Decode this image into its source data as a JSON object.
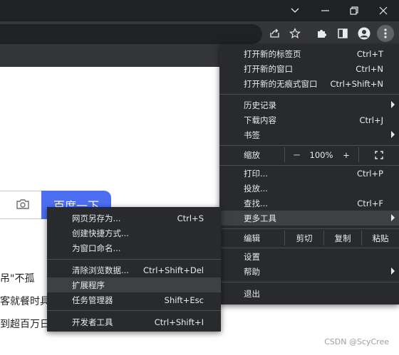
{
  "window_controls": {
    "tab_list_icon": "chevron-down-icon",
    "minimize_icon": "minimize-icon",
    "restore_icon": "restore-icon",
    "close_icon": "close-icon"
  },
  "toolbar": {
    "icons": [
      "share-icon",
      "star-icon",
      "puzzle-icon",
      "sidebar-icon",
      "profile-icon",
      "more-vert-icon"
    ]
  },
  "page": {
    "search_button": "百度一下",
    "camera_icon": "camera-icon",
    "text_lines": [
      "吊\"不孤",
      "客就餐时具",
      "到超百万日"
    ]
  },
  "main_menu": {
    "new_tab": {
      "label": "打开新的标签页",
      "shortcut": "Ctrl+T"
    },
    "new_window": {
      "label": "打开新的窗口",
      "shortcut": "Ctrl+N"
    },
    "incognito": {
      "label": "打开新的无痕式窗口",
      "shortcut": "Ctrl+Shift+N"
    },
    "history": {
      "label": "历史记录"
    },
    "downloads": {
      "label": "下载内容",
      "shortcut": "Ctrl+J"
    },
    "bookmarks": {
      "label": "书签"
    },
    "zoom": {
      "label": "缩放",
      "minus": "－",
      "value": "100%",
      "plus": "+",
      "fullscreen_icon": "fullscreen-icon"
    },
    "print": {
      "label": "打印...",
      "shortcut": "Ctrl+P"
    },
    "cast": {
      "label": "投放..."
    },
    "find": {
      "label": "查找...",
      "shortcut": "Ctrl+F"
    },
    "more_tools": {
      "label": "更多工具"
    },
    "edit": {
      "label": "编辑",
      "cut": "剪切",
      "copy": "复制",
      "paste": "粘贴"
    },
    "settings": {
      "label": "设置"
    },
    "help": {
      "label": "帮助"
    },
    "exit": {
      "label": "退出"
    }
  },
  "sub_menu": {
    "save_page": {
      "label": "网页另存为...",
      "shortcut": "Ctrl+S"
    },
    "create_shortcut": {
      "label": "创建快捷方式..."
    },
    "name_window": {
      "label": "为窗口命名..."
    },
    "clear_data": {
      "label": "清除浏览数据...",
      "shortcut": "Ctrl+Shift+Del"
    },
    "extensions": {
      "label": "扩展程序"
    },
    "task_manager": {
      "label": "任务管理器",
      "shortcut": "Shift+Esc"
    },
    "dev_tools": {
      "label": "开发者工具",
      "shortcut": "Ctrl+Shift+I"
    }
  },
  "watermark": "CSDN @ScyCree"
}
